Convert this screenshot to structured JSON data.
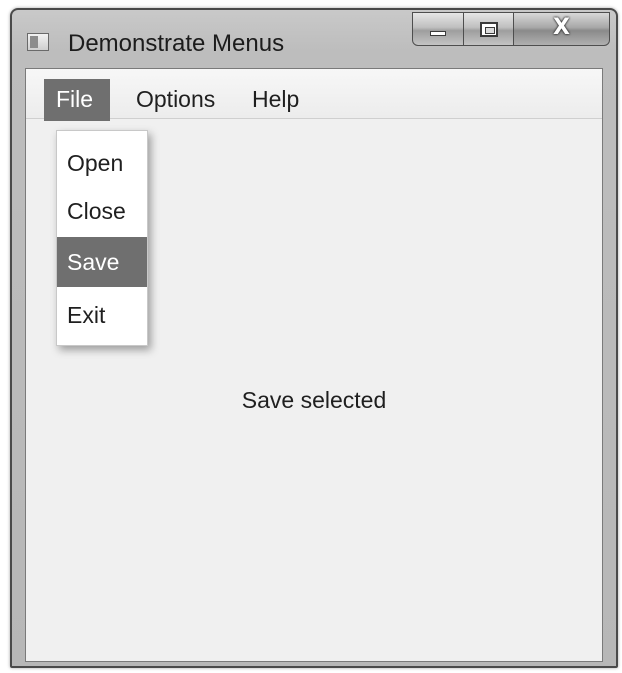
{
  "window": {
    "title": "Demonstrate Menus",
    "icon": "app-window-icon",
    "caption_buttons": {
      "minimize_icon": "minimize-icon",
      "maximize_icon": "maximize-icon",
      "close_glyph": "X"
    }
  },
  "menubar": {
    "items": [
      {
        "label": "File",
        "active": true
      },
      {
        "label": "Options",
        "active": false
      },
      {
        "label": "Help",
        "active": false
      }
    ]
  },
  "file_menu": {
    "items": [
      {
        "label": "Open",
        "highlighted": false
      },
      {
        "label": "Close",
        "highlighted": false
      },
      {
        "label": "Save",
        "highlighted": true
      },
      {
        "label": "Exit",
        "highlighted": false
      }
    ]
  },
  "main": {
    "status_text": "Save selected"
  },
  "colors": {
    "highlight": "#6f6f6f",
    "client_background": "#f0f0f0",
    "menu_background": "#ffffff"
  }
}
